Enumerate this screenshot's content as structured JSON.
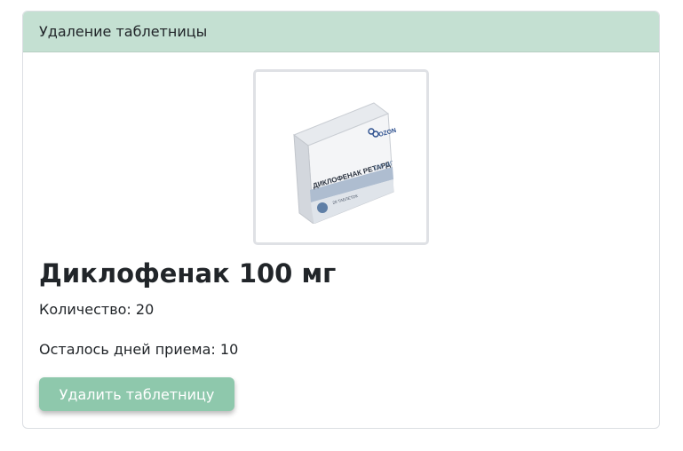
{
  "card": {
    "header_title": "Удаление таблетницы"
  },
  "product": {
    "title": "Диклофенак 100 мг",
    "quantity_text": "Количество: 20",
    "days_left_text": "Осталось дней приема: 10",
    "image": {
      "brand": "OZON",
      "name": "ДИКЛОФЕНАК РЕТАРД",
      "dose": "100 МГ",
      "count": "20 ТАБЛЕТОК"
    }
  },
  "actions": {
    "delete_label": "Удалить таблетницу"
  },
  "colors": {
    "header_bg": "#c4e0d2",
    "button_bg": "#8ec8ac",
    "text": "#212529"
  }
}
